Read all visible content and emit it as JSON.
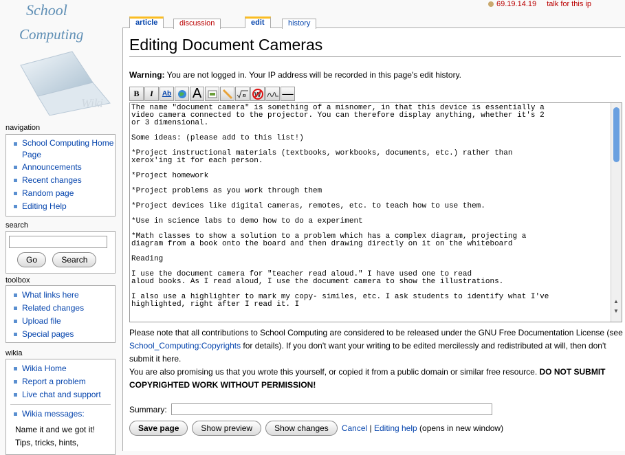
{
  "logo": {
    "line1": "School",
    "line2": "Computing",
    "line3": "Wiki"
  },
  "navigation": {
    "title": "navigation",
    "items": [
      "School Computing Home Page",
      "Announcements",
      "Recent changes",
      "Random page",
      "Editing Help"
    ]
  },
  "search": {
    "title": "search",
    "go_label": "Go",
    "search_label": "Search"
  },
  "toolbox": {
    "title": "toolbox",
    "items": [
      "What links here",
      "Related changes",
      "Upload file",
      "Special pages"
    ]
  },
  "wikia": {
    "title": "wikia",
    "items": [
      "Wikia Home",
      "Report a problem",
      "Live chat and support",
      "Wikia messages:"
    ],
    "message_lines": [
      "Name it and we got it!",
      "Tips, tricks, hints,"
    ]
  },
  "userbar": {
    "ip": "69.19.14.19",
    "talk": "talk for this ip"
  },
  "tabs": {
    "article": "article",
    "discussion": "discussion",
    "edit": "edit",
    "history": "history"
  },
  "page_title": "Editing Document Cameras",
  "warning": {
    "label": "Warning:",
    "text": " You are not logged in. Your IP address will be recorded in this page's edit history."
  },
  "toolbar": {
    "bold": "B",
    "italic": "I",
    "link": "Ab",
    "headline": "A",
    "sig": "—"
  },
  "editor_text": "The name \"document camera\" is something of a misnomer, in that this device is essentially a\nvideo camera connected to the projector. You can therefore display anything, whether it's 2\nor 3 dimensional.\n\nSome ideas: (please add to this list!)\n\n*Project instructional materials (textbooks, workbooks, documents, etc.) rather than\nxerox'ing it for each person.\n\n*Project homework\n\n*Project problems as you work through them\n\n*Project devices like digital cameras, remotes, etc. to teach how to use them.\n\n*Use in science labs to demo how to do a experiment\n\n*Math classes to show a solution to a problem which has a complex diagram, projecting a\ndiagram from a book onto the board and then drawing directly on it on the whiteboard\n\nReading\n\nI use the document camera for \"teacher read aloud.\" I have used one to read\naloud books. As I read aloud, I use the document camera to show the illustrations.\n\nI also use a highlighter to mark my copy- similes, etc. I ask students to identify what I've\nhighlighted, right after I read it. I",
  "notice": {
    "p1_a": "Please note that all contributions to School Computing are considered to be released under the GNU Free Documentation License (see ",
    "p1_link": "School_Computing:Copyrights",
    "p1_b": " for details). If you don't want your writing to be edited mercilessly and redistributed at will, then don't submit it here.",
    "p2_a": "You are also promising us that you wrote this yourself, or copied it from a public domain or similar free resource. ",
    "p2_bold": "DO NOT SUBMIT COPYRIGHTED WORK WITHOUT PERMISSION!"
  },
  "summary": {
    "label": "Summary:",
    "value": ""
  },
  "buttons": {
    "save": "Save page",
    "preview": "Show preview",
    "changes": "Show changes",
    "cancel": "Cancel",
    "sep": " | ",
    "editing_help": "Editing help",
    "new_window": " (opens in new window)"
  }
}
